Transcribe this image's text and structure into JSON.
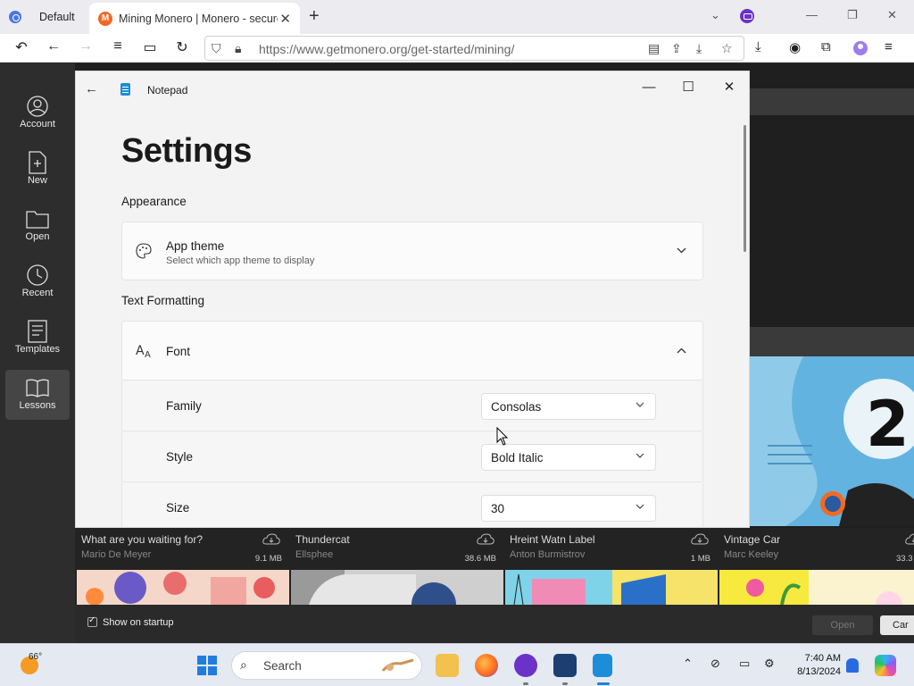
{
  "browser": {
    "profile_tab": "Default",
    "active_tab_title": "Mining Monero | Monero - secure, private, untraceable",
    "active_tab_favicon": "M",
    "url": "https://www.getmonero.org/get-started/mining/"
  },
  "bg_sidebar": [
    {
      "label": "Account"
    },
    {
      "label": "New"
    },
    {
      "label": "Open"
    },
    {
      "label": "Recent"
    },
    {
      "label": "Templates"
    },
    {
      "label": "Lessons"
    }
  ],
  "cards": [
    {
      "title": "What are you waiting for?",
      "author": "Mario De Meyer",
      "size": "9.1 MB"
    },
    {
      "title": "Thundercat",
      "author": "Ellsphee",
      "size": "38.6 MB"
    },
    {
      "title": "Hreint Watn Label",
      "author": "Anton Burmistrov",
      "size": "1 MB"
    },
    {
      "title": "Vintage Car",
      "author": "Marc Keeley",
      "size": "33.3"
    }
  ],
  "bottom": {
    "show_on_startup": "Show on startup",
    "open_label": "Open",
    "cancel_label": "Car"
  },
  "notepad": {
    "app_title": "Notepad",
    "heading": "Settings",
    "appearance": {
      "section": "Appearance",
      "theme_label": "App theme",
      "theme_desc": "Select which app theme to display"
    },
    "text_formatting": {
      "section": "Text Formatting",
      "font_label": "Font",
      "family_label": "Family",
      "family_value": "Consolas",
      "style_label": "Style",
      "style_value": "Bold Italic",
      "size_label": "Size",
      "size_value": "30"
    }
  },
  "taskbar": {
    "temperature": "66°",
    "search_label": "Search",
    "time": "7:40 AM",
    "date": "8/13/2024"
  },
  "colors": {
    "accent_blue": "#1f7de0",
    "monero_orange": "#f26822",
    "dark_bg": "#1f1f1f"
  }
}
